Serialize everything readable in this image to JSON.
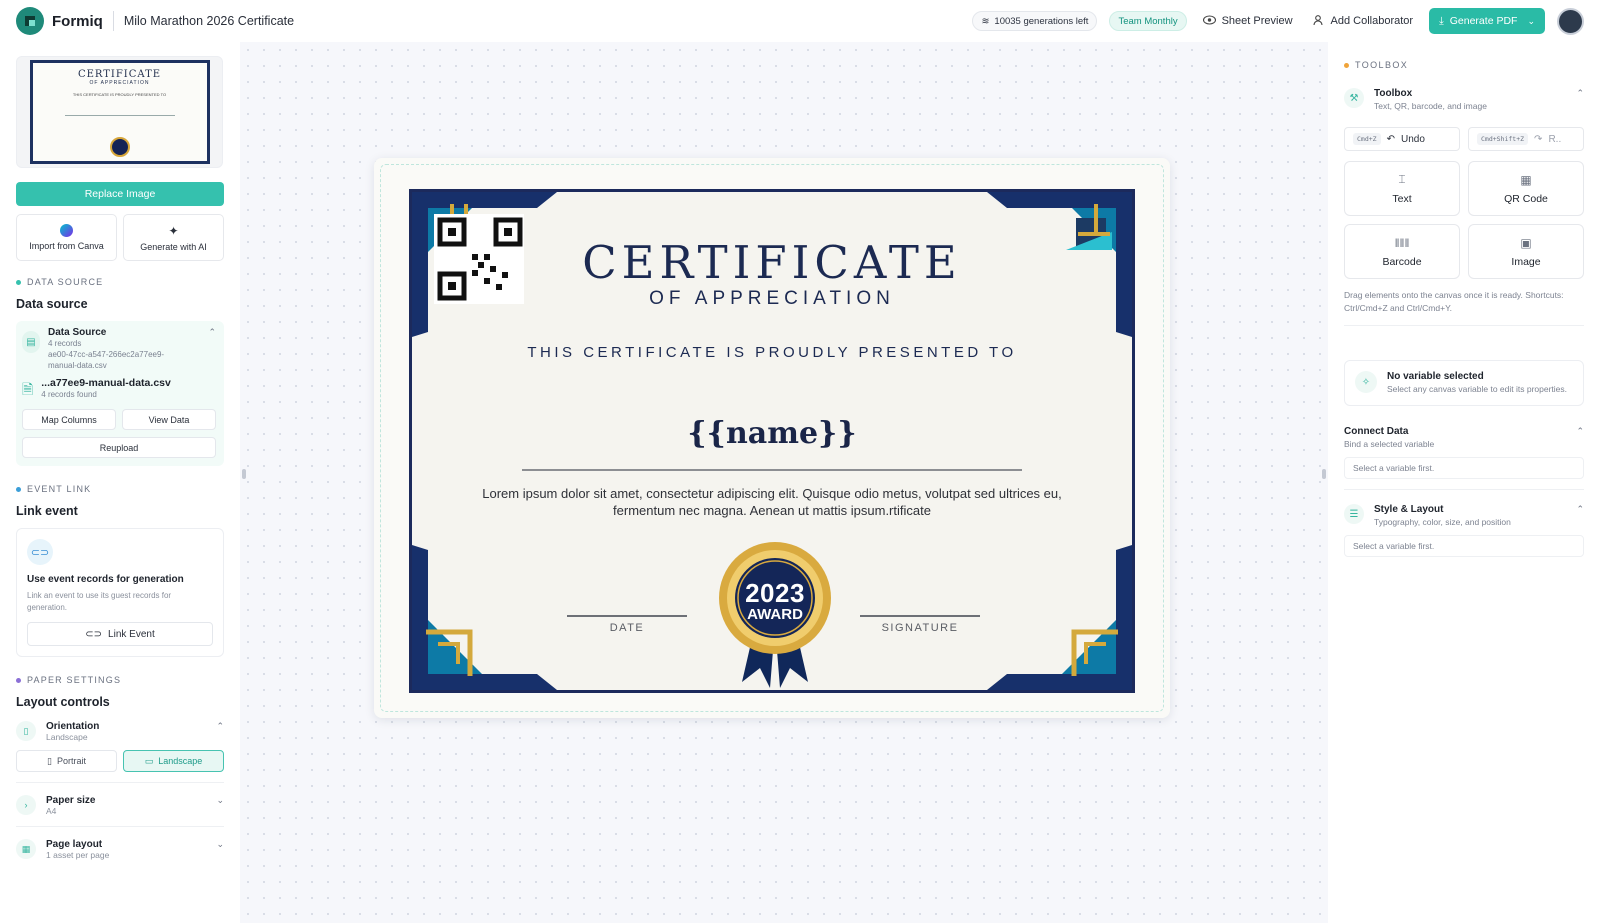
{
  "header": {
    "brand": "Formiq",
    "doc_title": "Milo Marathon 2026 Certificate",
    "generations": "10035 generations left",
    "plan": "Team Monthly",
    "sheet_preview": "Sheet Preview",
    "add_collaborator": "Add Collaborator",
    "generate_pdf": "Generate PDF"
  },
  "left": {
    "thumb": {
      "title": "CERTIFICATE",
      "subtitle": "OF APPRECIATION",
      "presented": "THIS CERTIFICATE IS PROUDLY PRESENTED TO",
      "medal": "2023"
    },
    "replace_image": "Replace Image",
    "import_canva": "Import from Canva",
    "generate_ai": "Generate with AI",
    "data_source": {
      "section": "DATA SOURCE",
      "title": "Data source",
      "name": "Data Source",
      "records": "4 records",
      "file_id": "ae00-47cc-a547-266ec2a77ee9-",
      "file_tail": "manual-data.csv",
      "file_short": "...a77ee9-manual-data.csv",
      "found": "4 records found",
      "map_columns": "Map Columns",
      "view_data": "View Data",
      "reupload": "Reupload"
    },
    "event": {
      "section": "EVENT LINK",
      "title": "Link event",
      "card_title": "Use event records for generation",
      "card_desc": "Link an event to use its guest records for generation.",
      "button": "Link Event"
    },
    "paper": {
      "section": "PAPER SETTINGS",
      "title": "Layout controls",
      "orientation": "Orientation",
      "orientation_value": "Landscape",
      "portrait": "Portrait",
      "landscape": "Landscape",
      "paper_size": "Paper size",
      "paper_size_value": "A4",
      "page_layout": "Page layout",
      "page_layout_value": "1 asset per page"
    }
  },
  "certificate": {
    "title": "CERTIFICATE",
    "subtitle": "OF APPRECIATION",
    "presented": "THIS CERTIFICATE IS PROUDLY PRESENTED TO",
    "name_var": "{{name}}",
    "body": "Lorem ipsum dolor sit amet, consectetur adipiscing elit. Quisque odio metus, volutpat sed ultrices eu, fermentum nec magna. Aenean ut mattis ipsum.rtificate",
    "date_label": "DATE",
    "signature_label": "SIGNATURE",
    "medal_year": "2023",
    "medal_word": "AWARD"
  },
  "right": {
    "section": "TOOLBOX",
    "toolbox_title": "Toolbox",
    "toolbox_sub": "Text, QR, barcode, and image",
    "undo_kbd": "Cmd+Z",
    "undo": "Undo",
    "redo_kbd": "Cmd+Shift+Z",
    "redo": "R..",
    "tools": [
      "Text",
      "QR Code",
      "Barcode",
      "Image"
    ],
    "help": "Drag elements onto the canvas once it is ready. Shortcuts: Ctrl/Cmd+Z and Ctrl/Cmd+Y.",
    "novar_title": "No variable selected",
    "novar_desc": "Select any canvas variable to edit its properties.",
    "connect_title": "Connect Data",
    "connect_sub": "Bind a selected variable",
    "connect_placeholder": "Select a variable first.",
    "style_title": "Style & Layout",
    "style_sub": "Typography, color, size, and position",
    "style_placeholder": "Select a variable first."
  },
  "colors": {
    "accent": "#2abba6",
    "navy": "#1c2a5c",
    "gold": "#d7a63a"
  }
}
